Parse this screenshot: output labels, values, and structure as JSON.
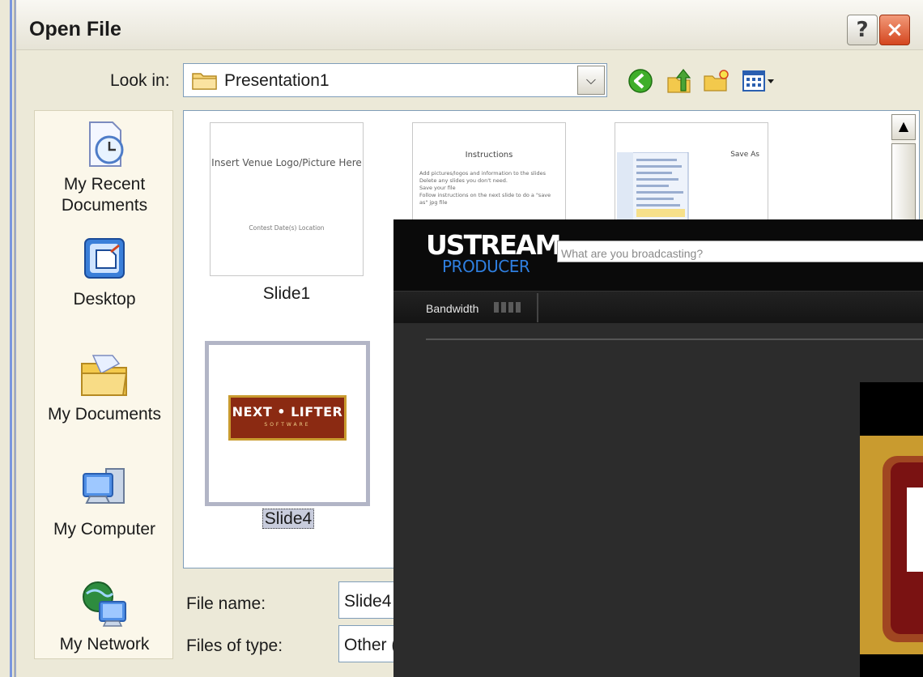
{
  "open_file_dialog": {
    "title": "Open File",
    "help_button": "?",
    "close_button": "×",
    "look_in": {
      "label": "Look in:",
      "value": "Presentation1"
    },
    "toolbar_icons": [
      "back-icon",
      "up-folder-icon",
      "new-folder-icon",
      "views-menu-icon"
    ],
    "places": [
      {
        "label": "My Recent Documents",
        "icon": "recent-documents-icon"
      },
      {
        "label": "Desktop",
        "icon": "desktop-icon"
      },
      {
        "label": "My Documents",
        "icon": "my-documents-icon"
      },
      {
        "label": "My Computer",
        "icon": "my-computer-icon"
      },
      {
        "label": "My Network",
        "icon": "my-network-icon"
      }
    ],
    "files": [
      {
        "caption": "Slide1",
        "thumb_title": "Insert Venue Logo/Picture Here",
        "thumb_sub": "Contest Date(s) Location"
      },
      {
        "caption": "",
        "thumb_title": "Instructions",
        "thumb_lines": [
          "Add pictures/logos and information to the slides",
          "Delete any slides you don't need.",
          "Save your file",
          "Follow instructions on the next slide to do a \"save as\" jpg file"
        ]
      },
      {
        "caption": "",
        "thumb_title": "Save As"
      },
      {
        "caption": "Slide4",
        "thumb_logo": "NEXT • LIFTER",
        "thumb_logo_sub": "SOFTWARE"
      }
    ],
    "file_name": {
      "label": "File name:",
      "value": "Slide4"
    },
    "files_of_type": {
      "label": "Files of type:",
      "value": "Other ("
    }
  },
  "ustream_producer": {
    "logo": "USTREAM",
    "sub_logo": "PRODUCER",
    "search": {
      "placeholder": "What are you broadcasting?",
      "value": ""
    },
    "bandwidth_label": "Bandwidth"
  },
  "colors": {
    "dialog_bg": "#ece9d8",
    "xp_close": "#d4461f",
    "ustream_bg": "#2c2c2c",
    "ustream_accent": "#2f7fe0",
    "lifter_logo_red": "#8b2a12",
    "lifter_logo_gold": "#c99b2f"
  }
}
